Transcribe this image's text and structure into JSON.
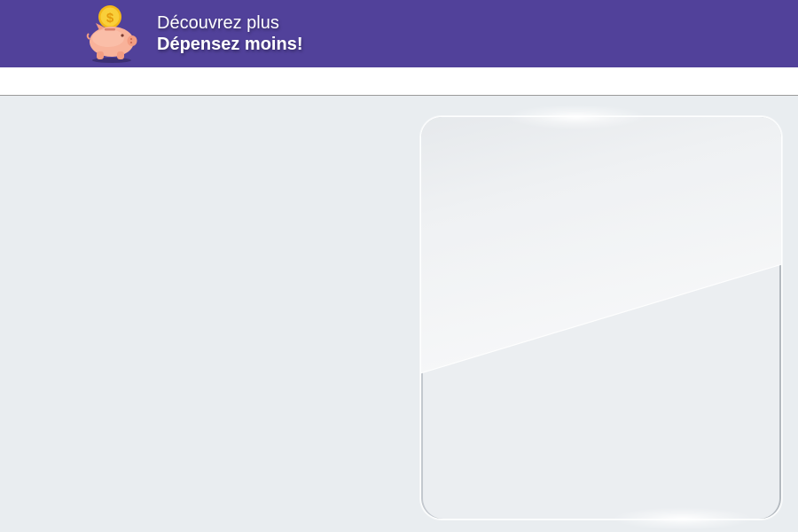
{
  "header": {
    "logo_icon": "piggy-bank-coin-icon",
    "tagline_line1": "Découvrez plus",
    "tagline_line2": "Dépensez moins!"
  },
  "colors": {
    "header_background": "#51419a",
    "page_background": "#e9edf0",
    "piggy_pink": "#f7a98f",
    "coin_gold": "#f5c518"
  }
}
